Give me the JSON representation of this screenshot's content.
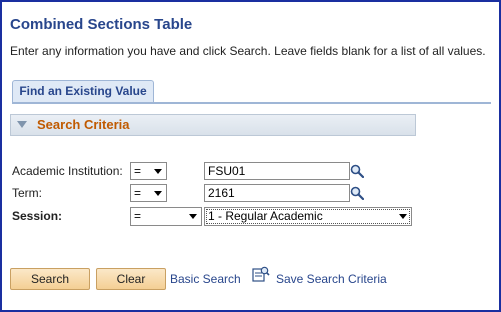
{
  "page": {
    "title": "Combined Sections Table",
    "instructions": "Enter any information you have and click Search. Leave fields blank for a list of all values."
  },
  "tabs": [
    {
      "label": "Find an Existing Value"
    }
  ],
  "search_criteria": {
    "header": "Search Criteria",
    "rows": [
      {
        "label": "Academic Institution:",
        "operator": "=",
        "value": "FSU01",
        "has_lookup": true
      },
      {
        "label": "Term:",
        "operator": "=",
        "value": "2161",
        "has_lookup": true
      },
      {
        "label": "Session:",
        "operator": "=",
        "value": "1 - Regular Academic",
        "has_lookup": false
      }
    ]
  },
  "actions": {
    "search_label": "Search",
    "clear_label": "Clear",
    "basic_search_label": "Basic Search",
    "save_criteria_label": "Save Search Criteria"
  },
  "icons": {
    "lookup": "magnifier-lookup-icon",
    "save_criteria": "save-criteria-icon",
    "collapse": "collapse-triangle-icon"
  },
  "colors": {
    "title": "#28468c",
    "section_header": "#c05a00",
    "button_fill": "#f4cf94",
    "frame_border": "#1a2fa0"
  }
}
